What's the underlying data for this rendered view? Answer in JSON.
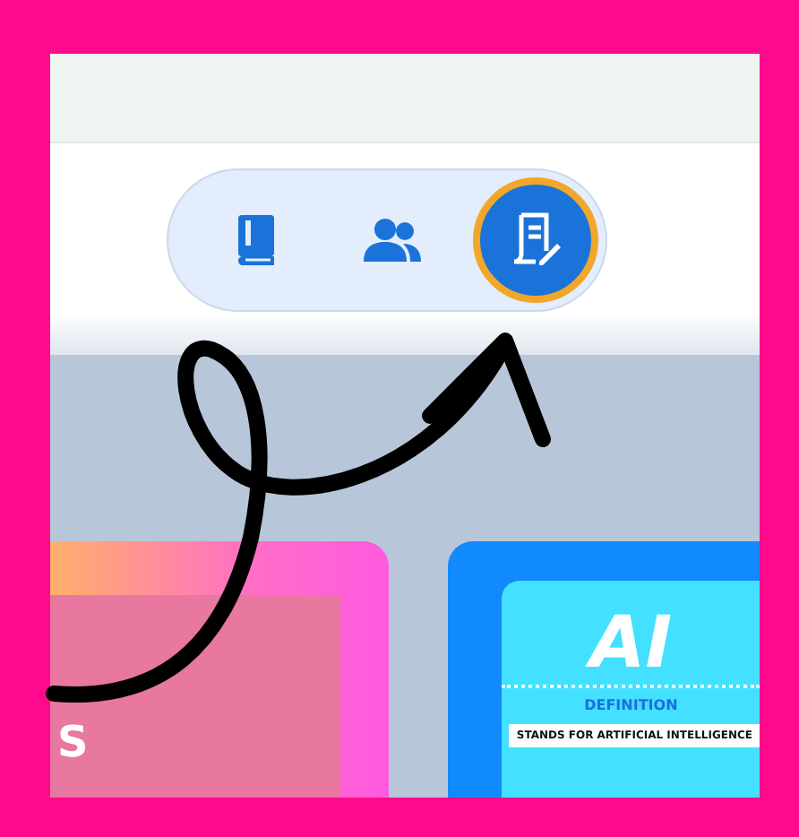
{
  "toolbar": {
    "buttons": [
      {
        "kind": "book",
        "selected": false
      },
      {
        "kind": "people",
        "selected": false
      },
      {
        "kind": "notes",
        "selected": true
      }
    ]
  },
  "cards": [
    {
      "kind": "poster",
      "text": "S"
    },
    {
      "kind": "definition",
      "title": "AI",
      "label": "DEFINITION",
      "body": "STANDS FOR ARTIFICIAL INTELLIGENCE"
    }
  ]
}
